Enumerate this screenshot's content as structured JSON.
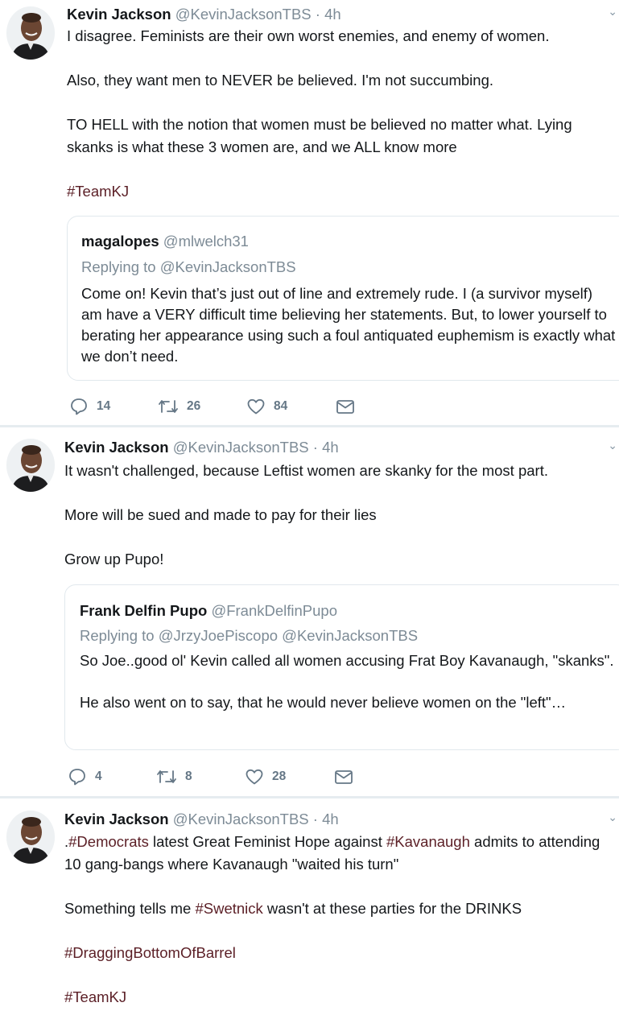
{
  "colors": {
    "hashtag": "#5b1f26",
    "muted": "#7d8b96",
    "divider": "#e6ecf0"
  },
  "tweets": [
    {
      "name": "Kevin Jackson",
      "handle": "@KevinJacksonTBS",
      "time": "· 4h",
      "paragraphs": [
        "I disagree. Feminists are their own worst enemies, and enemy of women.",
        "Also, they want men to NEVER be believed. I'm not succumbing.",
        "TO HELL with the notion that women must be believed no matter what. Lying skanks is what these 3 women are, and we ALL know more"
      ],
      "hashtag": "#TeamKJ",
      "quote": {
        "name": "magalopes",
        "handle": "@mlwelch31",
        "replying": "Replying to @KevinJacksonTBS",
        "text": "Come on! Kevin that’s just out of line and extremely rude. I (a survivor myself) am have a VERY difficult time believing her statements. But, to lower yourself to berating her appearance using such a foul antiquated euphemism is exactly what we don’t need."
      },
      "replies": "14",
      "retweets": "26",
      "likes": "84"
    },
    {
      "name": "Kevin Jackson",
      "handle": "@KevinJacksonTBS",
      "time": "· 4h",
      "paragraphs": [
        "It wasn't challenged, because Leftist women are skanky for the most part.",
        "More will be sued and made to pay for their lies",
        "Grow up Pupo!"
      ],
      "quote": {
        "name": "Frank Delfin Pupo",
        "handle": "@FrankDelfinPupo",
        "replying": "Replying to @JrzyJoePiscopo @KevinJacksonTBS",
        "text": "So Joe..good ol' Kevin called all women accusing Frat Boy Kavanaugh, \"skanks\".",
        "text2": "He also went on to say, that he would never believe women on the \"left\"…"
      },
      "replies": "4",
      "retweets": "8",
      "likes": "28"
    },
    {
      "name": "Kevin Jackson",
      "handle": "@KevinJacksonTBS",
      "time": "· 4h",
      "line1_pre": ".",
      "tag_democrats": "#Democrats",
      "line1_mid": " latest Great Feminist Hope against ",
      "tag_kavanaugh": "#Kavanaugh",
      "line1_post": " admits to attending 10 gang-bangs where Kavanaugh \"waited his turn\"",
      "line2_pre": "Something tells me ",
      "tag_swetnick": "#Swetnick",
      "line2_post": " wasn't at these parties for the DRINKS",
      "tag_dragging": "#DraggingBottomOfBarrel",
      "tag_teamkj": "#TeamKJ"
    }
  ]
}
